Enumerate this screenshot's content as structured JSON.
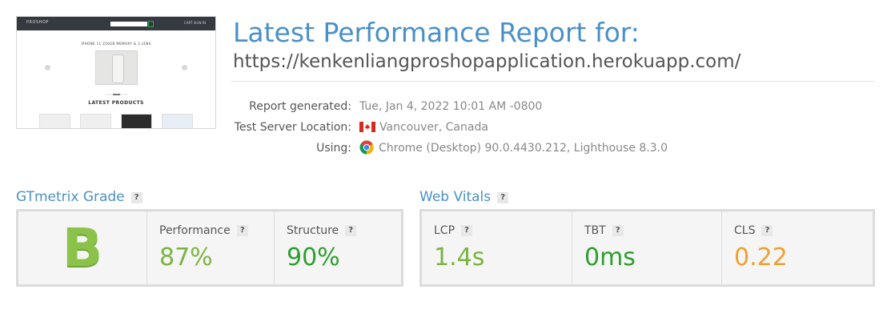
{
  "thumbnail": {
    "brand": "PROSHOP",
    "nav_links": "CART  SIGN IN",
    "caption": "IPHONE 11 256GB MEMORY & 3 LENS",
    "latest": "LATEST PRODUCTS"
  },
  "header": {
    "title": "Latest Performance Report for:",
    "url": "https://kenkenliangproshopapplication.herokuapp.com/"
  },
  "meta": {
    "report_generated_label": "Report generated:",
    "report_generated_value": "Tue, Jan 4, 2022 10:01 AM -0800",
    "location_label": "Test Server Location:",
    "location_value": "Vancouver, Canada",
    "using_label": "Using:",
    "using_value": "Chrome (Desktop) 90.0.4430.212, Lighthouse 8.3.0"
  },
  "gtmetrix": {
    "title": "GTmetrix Grade",
    "help": "?",
    "grade": "B",
    "performance_label": "Performance",
    "performance_value": "87%",
    "structure_label": "Structure",
    "structure_value": "90%"
  },
  "web_vitals": {
    "title": "Web Vitals",
    "help": "?",
    "lcp_label": "LCP",
    "lcp_value": "1.4s",
    "tbt_label": "TBT",
    "tbt_value": "0ms",
    "cls_label": "CLS",
    "cls_value": "0.22"
  },
  "colors": {
    "accent": "#4a90c8",
    "grade_green": "#8bc34a",
    "good_light_green": "#7cb342",
    "good_green": "#2e9e2e",
    "warning_orange": "#f0a030"
  },
  "icons": [
    "canada-flag-icon",
    "chrome-icon",
    "help-icon"
  ]
}
